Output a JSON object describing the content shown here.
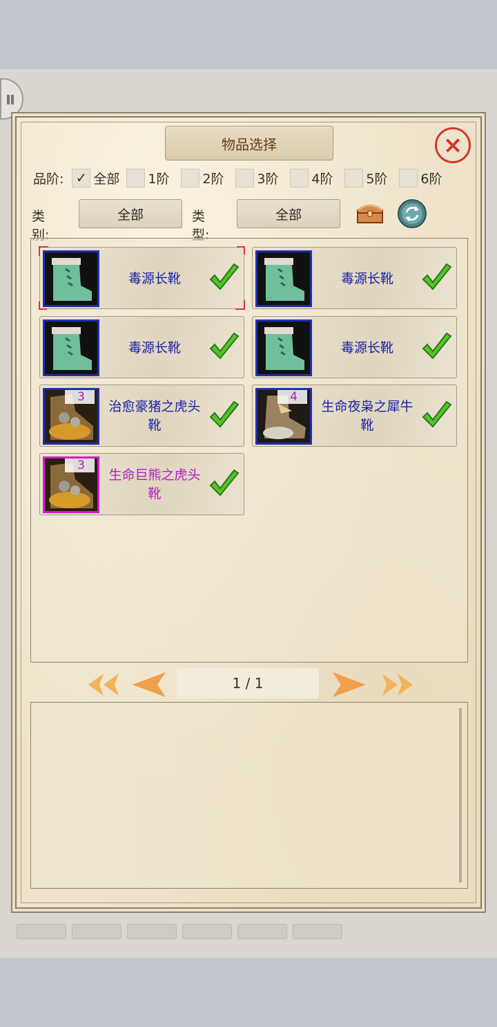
{
  "dialog": {
    "title": "物品选择",
    "close_icon": "close-icon"
  },
  "quality_filter": {
    "label": "品阶:",
    "options": [
      {
        "label": "全部",
        "checked": true
      },
      {
        "label": "1阶",
        "checked": false
      },
      {
        "label": "2阶",
        "checked": false
      },
      {
        "label": "3阶",
        "checked": false
      },
      {
        "label": "4阶",
        "checked": false
      },
      {
        "label": "5阶",
        "checked": false
      },
      {
        "label": "6阶",
        "checked": false
      }
    ]
  },
  "category": {
    "label": "类别:",
    "value": "全部"
  },
  "type": {
    "label": "类型:",
    "value": "全部"
  },
  "items": [
    {
      "name": "毒源长靴",
      "level": "",
      "name_color": "#1a23a8",
      "frame": "blue",
      "selected": true,
      "checked": true
    },
    {
      "name": "毒源长靴",
      "level": "",
      "name_color": "#1a23a8",
      "frame": "blue",
      "selected": false,
      "checked": true
    },
    {
      "name": "毒源长靴",
      "level": "",
      "name_color": "#1a23a8",
      "frame": "blue",
      "selected": false,
      "checked": true
    },
    {
      "name": "毒源长靴",
      "level": "",
      "name_color": "#1a23a8",
      "frame": "blue",
      "selected": false,
      "checked": true
    },
    {
      "name": "治愈豪猪之虎头靴",
      "level": "3",
      "name_color": "#1a23a8",
      "frame": "blue",
      "selected": false,
      "checked": true
    },
    {
      "name": "生命夜枭之犀牛靴",
      "level": "4",
      "name_color": "#1a23a8",
      "frame": "blue",
      "selected": false,
      "checked": true
    },
    {
      "name": "生命巨熊之虎头靴",
      "level": "3",
      "name_color": "#b21ec4",
      "frame": "purple",
      "selected": false,
      "checked": true
    }
  ],
  "pager": {
    "text": "1 / 1"
  }
}
